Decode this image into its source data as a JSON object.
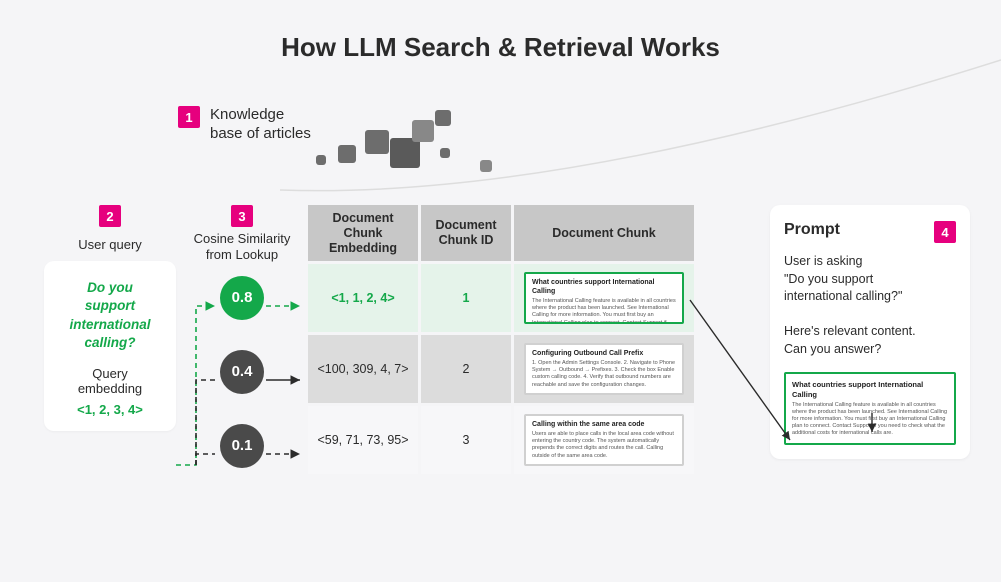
{
  "title": "How LLM Search & Retrieval Works",
  "step1": {
    "num": "1",
    "label_l1": "Knowledge",
    "label_l2": "base of articles"
  },
  "step2": {
    "num": "2",
    "label": "User query"
  },
  "step3": {
    "num": "3",
    "label_l1": "Cosine Similarity",
    "label_l2": "from Lookup"
  },
  "step4": {
    "num": "4"
  },
  "user_query": {
    "question_l1": "Do you",
    "question_l2": "support",
    "question_l3": "international",
    "question_l4": "calling?",
    "sub_l1": "Query",
    "sub_l2": "embedding",
    "embedding": "<1, 2, 3, 4>"
  },
  "scores": {
    "r1": "0.8",
    "r2": "0.4",
    "r3": "0.1"
  },
  "table": {
    "h_emb_l1": "Document",
    "h_emb_l2": "Chunk",
    "h_emb_l3": "Embedding",
    "h_id_l1": "Document",
    "h_id_l2": "Chunk ID",
    "h_chunk": "Document Chunk",
    "r1_emb": "<1, 1, 2, 4>",
    "r1_id": "1",
    "r2_emb": "<100, 309, 4, 7>",
    "r2_id": "2",
    "r3_emb": "<59, 71, 73, 95>",
    "r3_id": "3",
    "doc1_title": "What countries support International Calling",
    "doc1_body": "The International Calling feature is available in all countries where the product has been launched. See International Calling for more information. You must first buy an International Calling plan to connect. Contact Support if you need to check what the additional costs for international calls are.",
    "doc2_title": "Configuring Outbound Call Prefix",
    "doc2_body": "1. Open the Admin Settings Console. 2. Navigate to Phone System → Outbound → Prefixes. 3. Check the box Enable custom calling code. 4. Verify that outbound numbers are reachable and save the configuration changes.",
    "doc3_title": "Calling within the same area code",
    "doc3_body": "Users are able to place calls in the local area code without entering the country code. The system automatically prepends the correct digits and routes the call. Calling outside of the same area code.",
    "doc3_foot": "Calling outside of the same area code."
  },
  "prompt": {
    "title": "Prompt",
    "body_l1": "User is asking",
    "body_l2": "\"Do you support",
    "body_l3": "international calling?\"",
    "body_l4": "Here's relevant content.",
    "body_l5": "Can you answer?",
    "doc_title": "What countries support International Calling",
    "doc_body": "The International Calling feature is available in all countries where the product has been launched. See International Calling for more information. You must first buy an International Calling plan to connect. Contact Support if you need to check what the additional costs for international calls are."
  }
}
